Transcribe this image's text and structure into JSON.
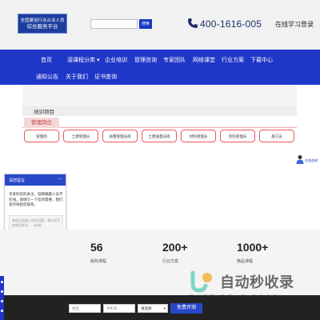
{
  "header": {
    "logo_line1": "全国建设行业从业人员",
    "logo_line2": "综合服务平台",
    "search_placeholder": "",
    "search_button": "搜索",
    "phone": "400-1616-005",
    "online_learning": "在线学习登录"
  },
  "nav": {
    "items": [
      "首页",
      "湿课程分类",
      "企业培训",
      "管理咨询",
      "专家团队",
      "网络课堂",
      "行业方案",
      "下载中心",
      "通知公告",
      "关于我们",
      "证书查询"
    ]
  },
  "training": {
    "title": "培训项目",
    "active_tab": "管理岗位",
    "cards": [
      "管理岗",
      "土建管理员",
      "质量管理员岗",
      "土建质量员岗",
      "材料管理员",
      "资料管理员",
      "施工员"
    ]
  },
  "service": {
    "label": "在线咨询"
  },
  "chat": {
    "title": "请您留言",
    "close": "−",
    "greeting": "亲爱的您的关注，但精确最人员不在线，请填写一下您的需要，我们会尽快给您联系。",
    "message_placeholder": "请您在此输入您的问题、我们会尽快和您联系。（必填）",
    "fields": [
      "姓名",
      "电话（必填）",
      "邮箱",
      "地址"
    ],
    "send": "提交"
  },
  "stats": [
    {
      "value": "56",
      "label": "版权课程"
    },
    {
      "value": "200+",
      "label": "行业方案"
    },
    {
      "value": "1000+",
      "label": "精品课程"
    }
  ],
  "watermark": {
    "text": "自动秒收录",
    "sub": "做 上 排 慢 · 来 访 一 次 · 自 动 收 录"
  },
  "bottom_form": {
    "name_placeholder": "姓名",
    "phone_placeholder": "手机号",
    "select_value": "请选择",
    "submit": "免费评测"
  },
  "colors": {
    "brand": "#1f37c9",
    "accent": "#e85a5a",
    "dark": "#222222"
  }
}
